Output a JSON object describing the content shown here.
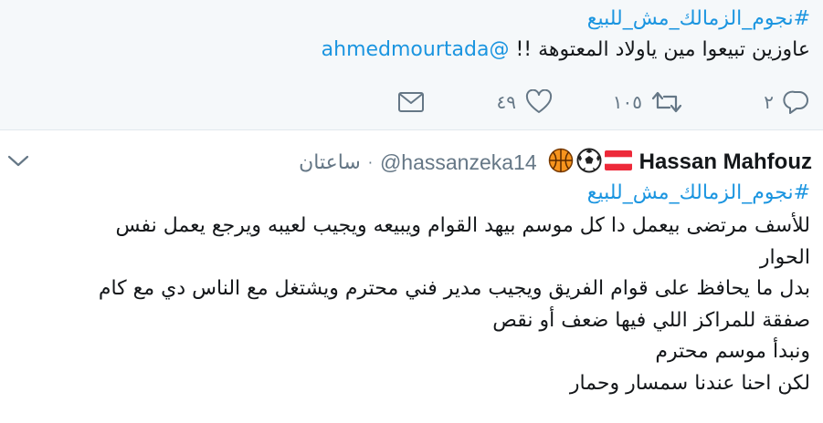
{
  "tweet_1": {
    "hashtag": "#نجوم_الزمالك_مش_للبيع",
    "text": "عاوزين تبيعوا مين ياولاد المعتوهة !!",
    "mention": "@ahmedmourtada",
    "actions": {
      "reply_count": "٢",
      "retweet_count": "١٠٥",
      "like_count": "٤٩"
    }
  },
  "tweet_2": {
    "author_name": "Hassan Mahfouz",
    "emojis": [
      "austria-flag",
      "soccer-ball",
      "basketball"
    ],
    "handle": "@hassanzeka14",
    "separator": "·",
    "time": "ساعتان",
    "hashtag": "#نجوم_الزمالك_مش_للبيع",
    "lines": [
      "للأسف مرتضى بيعمل دا كل موسم بيهد القوام ويبيعه ويجيب لعيبه ويرجع يعمل نفس",
      "الحوار",
      "بدل ما يحافظ على قوام الفريق ويجيب مدير فني محترم ويشتغل مع الناس دي مع كام",
      "صفقة للمراكز اللي فيها ضعف أو نقص",
      "ونبدأ موسم محترم",
      "لكن احنا عندنا سمسار وحمار"
    ]
  },
  "colors": {
    "link": "#1b95e0",
    "muted": "#657786",
    "text": "#14171a",
    "top_background": "#f5f8fa"
  }
}
